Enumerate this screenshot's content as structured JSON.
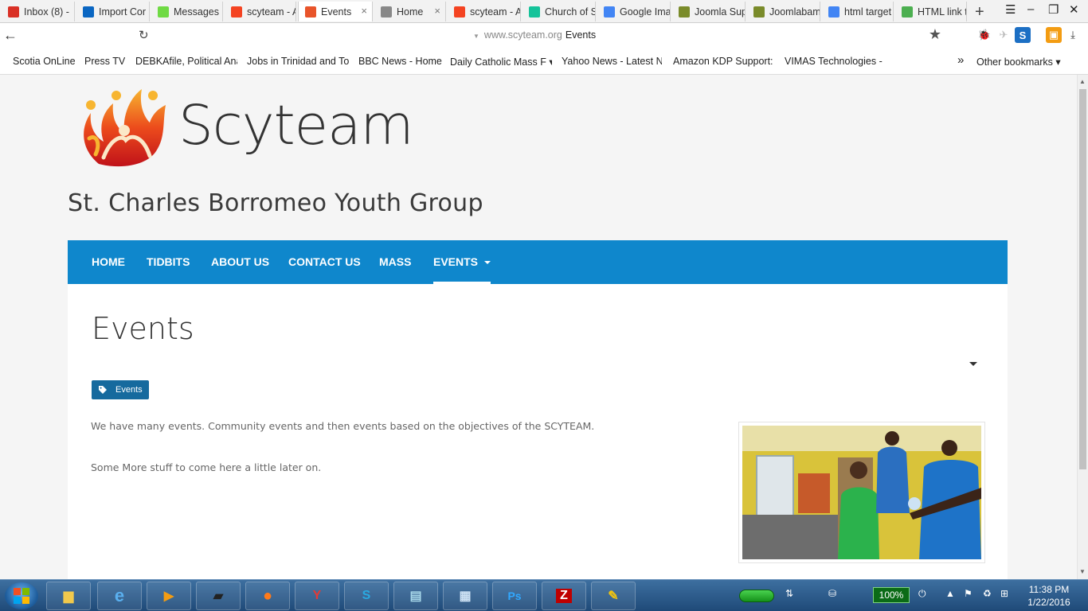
{
  "browser": {
    "tabs": [
      {
        "label": "Inbox (8) -",
        "icon": "gmail-icon",
        "color": "#d93025"
      },
      {
        "label": "Import Cor",
        "icon": "linkedin-icon",
        "color": "#0a66c2"
      },
      {
        "label": "Messages",
        "icon": "upwork-icon",
        "color": "#6fda44"
      },
      {
        "label": "scyteam - A",
        "icon": "joomla-icon",
        "color": "#f44321"
      },
      {
        "label": "Events",
        "icon": "scyteam-icon",
        "color": "#e8542a",
        "active": true
      },
      {
        "label": "Home",
        "icon": "page-icon",
        "color": "#888888"
      },
      {
        "label": "scyteam - A",
        "icon": "joomla-icon",
        "color": "#f44321"
      },
      {
        "label": "Church of S",
        "icon": "grammarly-icon",
        "color": "#15c39a"
      },
      {
        "label": "Google Ima",
        "icon": "google-icon",
        "color": "#4285f4"
      },
      {
        "label": "Joomla Sup",
        "icon": "joomla-support-icon",
        "color": "#7a8b2a"
      },
      {
        "label": "Joomlabam",
        "icon": "joomla-support-icon",
        "color": "#7a8b2a"
      },
      {
        "label": "html target",
        "icon": "google-icon",
        "color": "#4285f4"
      },
      {
        "label": "HTML link t",
        "icon": "w3-icon",
        "color": "#4caf50"
      }
    ],
    "close_glyph": "×",
    "new_tab_glyph": "+",
    "url_host": "www.scyteam.org",
    "url_title": "Events",
    "bookmarks": [
      "Scotia OnLine",
      "Press TV",
      "DEBKAfile, Political Ana",
      "Jobs in Trinidad and Tob",
      "BBC News - Home",
      "Daily Catholic Mass F ▾",
      "Yahoo News - Latest Ne",
      "Amazon KDP Support: I",
      "VIMAS Technologies - C"
    ],
    "bookmarks_more": "»",
    "other_bookmarks": "Other bookmarks ▾"
  },
  "site": {
    "brand": "Scyteam",
    "tagline": "St. Charles Borromeo Youth Group",
    "nav": [
      {
        "label": "HOME"
      },
      {
        "label": "TIDBITS"
      },
      {
        "label": "ABOUT US"
      },
      {
        "label": "CONTACT US"
      },
      {
        "label": "MASS"
      },
      {
        "label": "EVENTS",
        "active": true,
        "has_caret": true
      }
    ],
    "page_title": "Events",
    "tag_label": "Events",
    "paragraphs": [
      "We have many events.  Community events and then events based on the objectives of the SCYTEAM.",
      "Some More stuff to come here a little later on."
    ],
    "nav_color": "#0f87cc",
    "tag_color": "#166a9e"
  },
  "taskbar": {
    "battery_pct": "100%",
    "time": "11:38 PM",
    "date": "1/22/2016"
  }
}
